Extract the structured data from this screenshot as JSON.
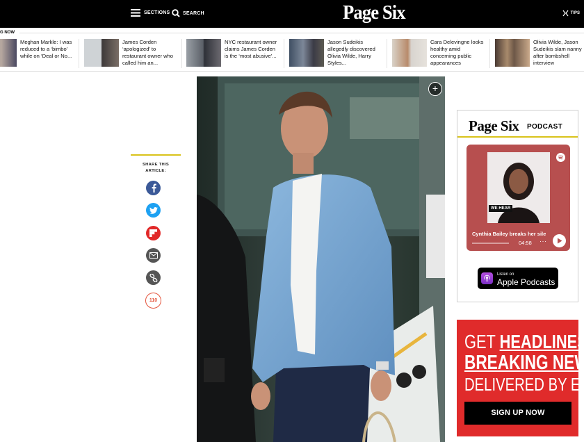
{
  "header": {
    "sections_label": "SECTIONS",
    "search_label": "SEARCH",
    "logo_text": "Page Six",
    "tips_label": "TIPS"
  },
  "trending": {
    "label": "G NOW",
    "items": [
      {
        "text": "Meghan Markle: I was reduced to a ‘bimbo’ while on ‘Deal or No..."
      },
      {
        "text": "James Corden ‘apologized’ to restaurant owner who called him an..."
      },
      {
        "text": "NYC restaurant owner claims James Corden is the ‘most abusive’..."
      },
      {
        "text": "Jason Sudeikis allegedly discovered Olivia Wilde, Harry Styles..."
      },
      {
        "text": "Cara Delevingne looks healthy amid concerning public appearances"
      },
      {
        "text": "Olivia Wilde, Jason Sudeikis slam nanny after bombshell interview"
      }
    ]
  },
  "share": {
    "title_line1": "SHARE THIS",
    "title_line2": "ARTICLE:",
    "comment_count": "110"
  },
  "podcast": {
    "title": "Page Six",
    "subtitle": "PODCAST",
    "episode_title": "Cynthia Bailey breaks her sile",
    "time": "04:58",
    "cover_badge": "WE HEAR",
    "apple_top": "Listen on",
    "apple_bottom": "Apple Podcasts"
  },
  "newsletter": {
    "line1_a": "GET ",
    "line1_b": "HEADLINES",
    "line1_c": " &",
    "line2": "BREAKING NEWS",
    "line3": "DELIVERED BY EMAIL",
    "button": "SIGN UP NOW"
  },
  "colors": {
    "brand_black": "#000000",
    "accent_yellow": "#d9c31a",
    "newsletter_red": "#e02b2b",
    "podcast_card": "#b74f4f",
    "facebook": "#3b5998",
    "twitter": "#1da1f2",
    "flipboard": "#e12828"
  }
}
